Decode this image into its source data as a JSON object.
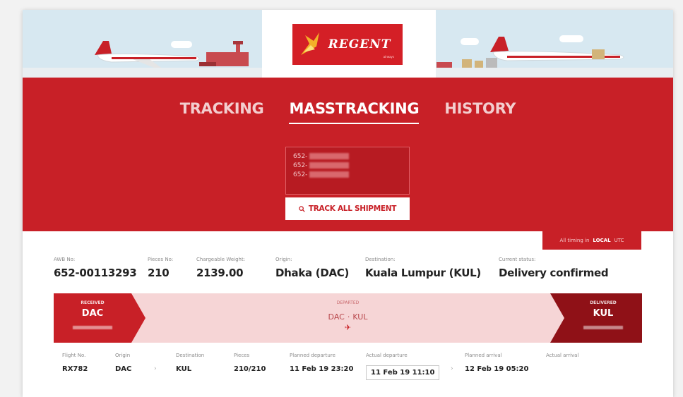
{
  "brand": {
    "wordmark": "REGENT",
    "tagline": "airways"
  },
  "nav": {
    "tabs": [
      {
        "label": "TRACKING",
        "active": false
      },
      {
        "label": "MASSTRACKING",
        "active": true
      },
      {
        "label": "HISTORY",
        "active": false
      }
    ]
  },
  "awb_input": {
    "lines": [
      "652-",
      "652-",
      "652-"
    ]
  },
  "track_button": {
    "icon": "search-icon",
    "label": "TRACK ALL SHIPMENT"
  },
  "timezone": {
    "prefix": "All timing in",
    "options": [
      "LOCAL",
      "UTC"
    ],
    "selected": "LOCAL"
  },
  "shipment": {
    "awb": {
      "label": "AWB No:",
      "value": "652-00113293"
    },
    "pieces": {
      "label": "Pieces No:",
      "value": "210"
    },
    "weight": {
      "label": "Chargeable Weight:",
      "value": "2139.00"
    },
    "origin": {
      "label": "Origin:",
      "value": "Dhaka (DAC)"
    },
    "destination": {
      "label": "Destination:",
      "value": "Kuala Lumpur (KUL)"
    },
    "status": {
      "label": "Current status:",
      "value": "Delivery confirmed"
    }
  },
  "status_strip": {
    "received": {
      "label": "RECEIVED",
      "code": "DAC"
    },
    "departed": {
      "label": "DEPARTED",
      "from": "DAC",
      "to": "KUL"
    },
    "delivered": {
      "label": "DELIVERED",
      "code": "KUL"
    }
  },
  "flight": {
    "headers": {
      "flight_no": "Flight No.",
      "origin": "Origin",
      "destination": "Destination",
      "pieces": "Pieces",
      "planned_departure": "Planned departure",
      "actual_departure": "Actual departure",
      "planned_arrival": "Planned arrival",
      "actual_arrival": "Actual arrival"
    },
    "row": {
      "flight_no": "RX782",
      "origin": "DAC",
      "destination": "KUL",
      "pieces": "210/210",
      "planned_departure": "11 Feb 19 23:20",
      "actual_departure": "11 Feb 19 11:10",
      "planned_arrival": "12 Feb 19 05:20",
      "actual_arrival": ""
    }
  },
  "colors": {
    "brand_red": "#c82027",
    "dark_red": "#8f1117",
    "strip_pink": "#f6d5d6"
  }
}
